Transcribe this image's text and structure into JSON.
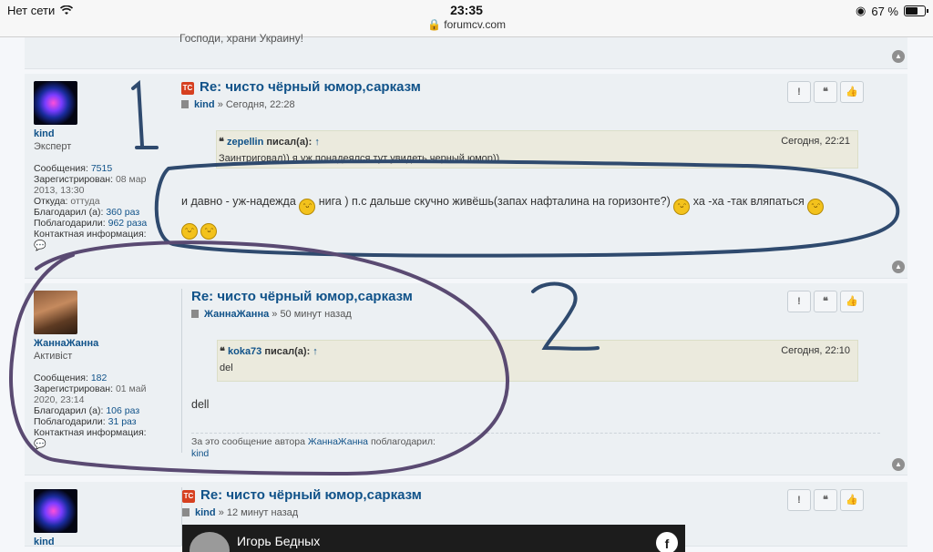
{
  "status_bar": {
    "network": "Нет сети",
    "time": "23:35",
    "url": "forumcv.com",
    "battery": "67 %",
    "battery_level": 0.67
  },
  "posts": [
    {
      "partial_text": "Господи, храни Украину!"
    },
    {
      "author": "kind",
      "rank": "Эксперт",
      "stats": [
        {
          "label": "Сообщения:",
          "value": "7515"
        },
        {
          "label": "Зарегистрирован:",
          "value": "08 мар 2013, 13:30"
        },
        {
          "label": "Откуда:",
          "value": "оттуда"
        },
        {
          "label": "Благодарил (а):",
          "value": "360 раз"
        },
        {
          "label": "Поблагодарили:",
          "value": "962 раза"
        },
        {
          "label": "Контактная информация:",
          "value": ""
        }
      ],
      "tc_badge": "TC",
      "title": "Re: чисто чёрный юмор,сарказм",
      "meta_author": "kind",
      "meta_time": "» Сегодня, 22:28",
      "quote": {
        "author": "zepellin",
        "said": "писал(а):",
        "arrow": "↑",
        "date": "Сегодня, 22:21",
        "text": "Заинтриговал)) я уж понадеялся тут увидеть черный юмор))"
      },
      "content": {
        "part1": "и давно - уж-надежда",
        "part2": "нига ) п.с дальше скучно живёшь(запах нафталина на горизонте?)",
        "part3": "ха -ха -так вляпаться"
      }
    },
    {
      "author": "ЖаннаЖанна",
      "rank": "Активіст",
      "stats": [
        {
          "label": "Сообщения:",
          "value": "182"
        },
        {
          "label": "Зарегистрирован:",
          "value": "01 май 2020, 23:14"
        },
        {
          "label": "Благодарил (а):",
          "value": "106 раз"
        },
        {
          "label": "Поблагодарили:",
          "value": "31 раз"
        },
        {
          "label": "Контактная информация:",
          "value": ""
        }
      ],
      "title": "Re: чисто чёрный юмор,сарказм",
      "meta_author": "ЖаннаЖанна",
      "meta_time": "» 50 минут назад",
      "quote": {
        "author": "koka73",
        "said": "писал(а):",
        "arrow": "↑",
        "date": "Сегодня, 22:10",
        "text": "del"
      },
      "content": "dell",
      "thanks": {
        "prefix": "За это сообщение автора",
        "author": "ЖаннаЖанна",
        "suffix": "поблагодарил:",
        "by": "kind"
      }
    },
    {
      "author": "kind",
      "tc_badge": "TC",
      "title": "Re: чисто чёрный юмор,сарказм",
      "meta_author": "kind",
      "meta_time": "» 12 минут назад",
      "video_title": "Игорь Бедных"
    }
  ],
  "buttons": {
    "report": "!",
    "quote": "❝",
    "like": "👍"
  },
  "annotations": {
    "mark1": "1",
    "mark2": "2",
    "color": "#2f4a6e",
    "color2": "#5a4a72"
  },
  "icons": [
    "wifi-icon",
    "lock-icon",
    "rotation-lock-icon",
    "battery-icon",
    "top-arrow-icon",
    "report-icon",
    "quote-icon",
    "like-icon",
    "contact-icon",
    "post-icon",
    "smiley-icon",
    "facebook-icon"
  ]
}
